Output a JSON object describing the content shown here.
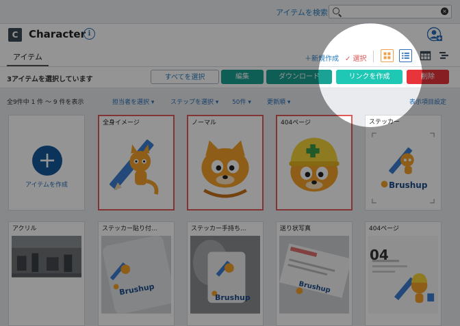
{
  "topbar": {
    "search_link": "アイテムを検索",
    "search_value": "",
    "clear_glyph": "×"
  },
  "header": {
    "logo_letter": "C",
    "title": "Character",
    "info_glyph": "i"
  },
  "tabs": [
    {
      "label": "アイテム"
    }
  ],
  "toolbar": {
    "new_item": "＋新規作成",
    "select_mode": "✓ 選択"
  },
  "actions": {
    "selection_text": "3アイテムを選択しています",
    "select_all": "すべてを選択",
    "edit": "編集",
    "download": "ダウンロード",
    "create_link": "リンクを作成",
    "delete": "削除"
  },
  "filters": {
    "count_text": "全9件中 1 件 〜 9 件を表示",
    "assignee": "担当者を選択 ▾",
    "step": "ステップを選択 ▾",
    "per_page": "50件 ▾",
    "sort": "更新順 ▾",
    "display_settings": "表示項目設定"
  },
  "create_card": {
    "plus_glyph": "+",
    "label": "アイテムを作成"
  },
  "items": [
    {
      "name": "全身イメージ",
      "selected": true,
      "thumb": "pencil-raccoon"
    },
    {
      "name": "ノーマル",
      "selected": true,
      "thumb": "raccoon-face"
    },
    {
      "name": "404ページ",
      "selected": true,
      "thumb": "raccoon-helmet"
    },
    {
      "name": "ステッカー",
      "selected": false,
      "thumb": "sticker-brushup"
    },
    {
      "name": "アクリル",
      "selected": false,
      "thumb": "photo-room"
    },
    {
      "name": "ステッカー貼り付...",
      "selected": false,
      "thumb": "laptop-brushup"
    },
    {
      "name": "ステッカー手持ち...",
      "selected": false,
      "thumb": "hand-brushup"
    },
    {
      "name": "送り状写真",
      "selected": false,
      "thumb": "invoice-photo"
    },
    {
      "name": "404ページ",
      "selected": false,
      "thumb": "page-404"
    }
  ],
  "brand_text": "Brushup",
  "page_404_text": "04",
  "colors": {
    "accent": "#2a6fb8",
    "teal": "#1aa394",
    "link_teal": "#1ec8b5",
    "danger": "#e8353c",
    "select_border": "#e05a5a",
    "raccoon_orange": "#f5a02a"
  }
}
